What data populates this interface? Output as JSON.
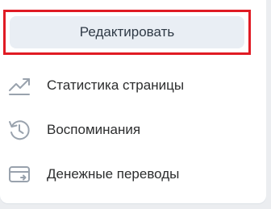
{
  "edit_button": {
    "label": "Редактировать"
  },
  "menu": {
    "items": [
      {
        "label": "Статистика страницы",
        "icon": "trending-up-icon"
      },
      {
        "label": "Воспоминания",
        "icon": "history-clock-icon"
      },
      {
        "label": "Денежные переводы",
        "icon": "money-transfer-card-icon"
      }
    ]
  },
  "colors": {
    "highlight": "#e01b24",
    "button_bg": "#e9eef4",
    "icon": "#99a2ad",
    "text": "#2c2d2e"
  }
}
